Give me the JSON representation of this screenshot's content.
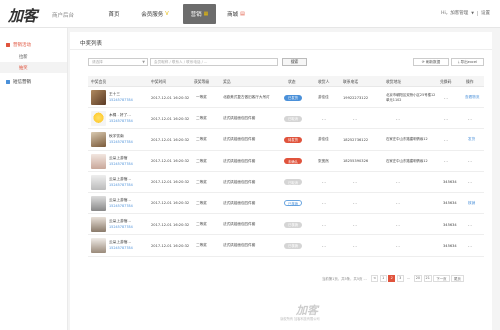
{
  "brand": {
    "logo": "加客",
    "subtitle": "商户后台"
  },
  "nav": [
    {
      "label": "首页",
      "icon": ""
    },
    {
      "label": "会员服务",
      "icon": "V"
    },
    {
      "label": "营销",
      "icon": "▦"
    },
    {
      "label": "商城",
      "icon": "▤"
    }
  ],
  "user": {
    "account": "Hi，加客管理",
    "role": "设置"
  },
  "sidebar": {
    "sections": [
      {
        "label": "营销活动",
        "color": "#e0533c",
        "items": [
          "拉新",
          "抽奖"
        ]
      },
      {
        "label": "短信营销",
        "color": "#4a90d9",
        "items": []
      }
    ]
  },
  "page": {
    "title": "中奖列表",
    "search": {
      "select_placeholder": "请选择",
      "placeholder": "会员昵称 / 联系人 / 联系电话 / ...",
      "button": "搜索"
    },
    "refresh_button": "刷新数据",
    "export_button": "导出excel"
  },
  "table": {
    "headers": [
      "中奖会员",
      "中奖时间",
      "获奖等级",
      "奖品",
      "状态",
      "收货人",
      "联系电话",
      "收货地址",
      "兑换码",
      "操作"
    ],
    "rows": [
      {
        "name": "王十三",
        "phone": "15245787784",
        "time": "2017-12-01  16:20:32",
        "level": "一等奖",
        "prize": "北欧美式复古做旧客厅大吊灯",
        "status": "已发货",
        "status_style": "blue",
        "receiver": "游佳佳",
        "tel": "19922273122",
        "address": "北京市朝阳区双桥小区25号楼12单元1102",
        "code": "- -",
        "op": "查看物流"
      },
      {
        "name": "木棉 . 好了...",
        "phone": "15245787784",
        "time": "2017-12-01  16:20:32",
        "level": "二等奖",
        "prize": "法式烘焙面包四件套",
        "status": "已取消",
        "status_style": "grey",
        "receiver": "- -",
        "tel": "- -",
        "address": "- -",
        "code": "- -",
        "op": "- -"
      },
      {
        "name": "秋字饮南",
        "phone": "15245787784",
        "time": "2017-12-01  16:20:32",
        "level": "二等奖",
        "prize": "法式烘焙面包四件套",
        "status": "待发货",
        "status_style": "red",
        "receiver": "游佳佳",
        "tel": "18252736122",
        "address": "石家庄中山东路建明情缘12",
        "code": "- -",
        "op": "发货"
      },
      {
        "name": "云朵上游宿",
        "phone": "15245787784",
        "time": "2017-12-01  16:20:32",
        "level": "二等奖",
        "prize": "法式烘焙面包四件套",
        "status": "未确认",
        "status_style": "red",
        "receiver": "张宽然",
        "tel": "18255390326",
        "address": "石家庄中山东路建明情缘12",
        "code": "- -",
        "op": "- -"
      },
      {
        "name": "云朵上游宿...",
        "phone": "15245787784",
        "time": "2017-12-01  16:20:32",
        "level": "二等奖",
        "prize": "法式烘焙面包四件套",
        "status": "已取消",
        "status_style": "grey",
        "receiver": "- -",
        "tel": "- -",
        "address": "- -",
        "code": "345634",
        "op": "- -"
      },
      {
        "name": "云朵上游宿...",
        "phone": "15245787784",
        "time": "2017-12-01  16:20:32",
        "level": "二等奖",
        "prize": "法式烘焙面包四件套",
        "status": "已核销",
        "status_style": "outline",
        "receiver": "- -",
        "tel": "- -",
        "address": "- -",
        "code": "345634",
        "op": "核销"
      },
      {
        "name": "云朵上游宿...",
        "phone": "15245787784",
        "time": "2017-12-01  16:20:32",
        "level": "二等奖",
        "prize": "法式烘焙面包四件套",
        "status": "已核销",
        "status_style": "grey",
        "receiver": "- -",
        "tel": "- -",
        "address": "- -",
        "code": "345634",
        "op": "- -"
      },
      {
        "name": "云朵上游宿...",
        "phone": "15245787784",
        "time": "2017-12-01  16:20:32",
        "level": "二等奖",
        "prize": "法式烘焙面包四件套",
        "status": "已核销",
        "status_style": "grey",
        "receiver": "- -",
        "tel": "- -",
        "address": "- -",
        "code": "345634",
        "op": "- -"
      }
    ]
  },
  "pagination": {
    "info": "当前第1页，共5条，共5页 ...",
    "prev": "<",
    "pages": [
      "1",
      "2",
      "3"
    ],
    "current": "2",
    "ellipsis": "...",
    "last_pages": [
      "20",
      "21"
    ],
    "next": "下一页",
    "last": "尾页"
  },
  "footer": {
    "logo": "加客",
    "copyright": "版权所有 加客科技有限公司"
  },
  "colors": {
    "accent": "#e0533c",
    "link": "#4a90d9"
  }
}
